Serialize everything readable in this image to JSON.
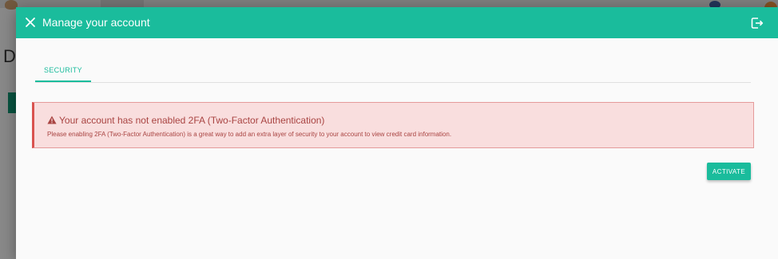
{
  "background": {
    "heading_letter": "D"
  },
  "dialog": {
    "title": "Manage your account",
    "close_icon": "close-icon",
    "logout_icon": "logout-icon",
    "tabs": [
      {
        "label": "SECURITY",
        "active": true
      }
    ],
    "alert": {
      "icon": "warning-icon",
      "heading": "Your account has not enabled 2FA (Two-Factor Authentication)",
      "message": "Please enabling 2FA (Two-Factor Authentication) is a great way to add an extra layer of security to your account to view credit card information."
    },
    "activate_label": "ACTIVATE"
  },
  "colors": {
    "accent": "#1abc9c",
    "alert_bg": "#f9dede",
    "alert_text": "#a94442",
    "alert_border": "#d9534f"
  }
}
